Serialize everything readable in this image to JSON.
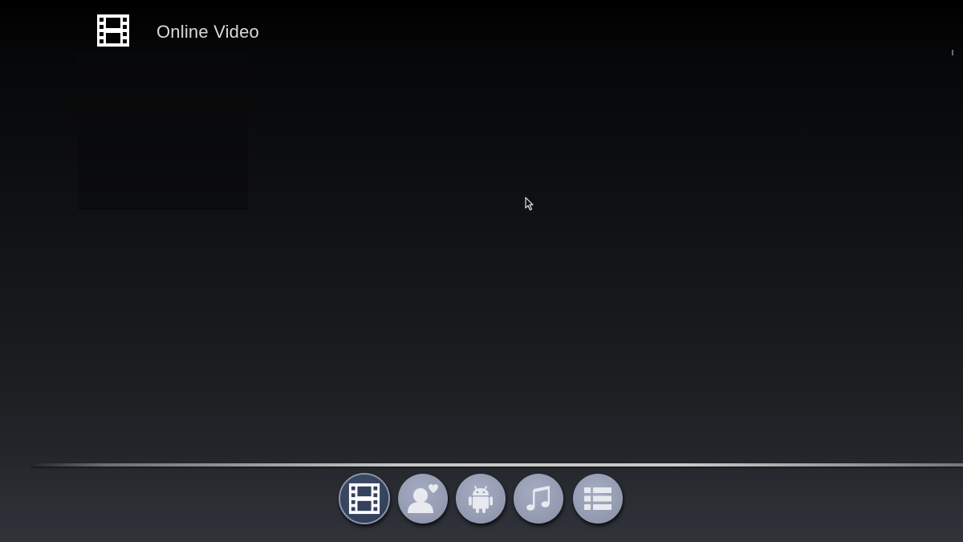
{
  "header": {
    "title": "Online Video",
    "icon": "film-icon"
  },
  "dock": {
    "items": [
      {
        "id": "videos",
        "icon": "film-icon",
        "active": true
      },
      {
        "id": "favorites",
        "icon": "user-heart-icon",
        "active": false
      },
      {
        "id": "programs",
        "icon": "android-icon",
        "active": false
      },
      {
        "id": "music",
        "icon": "music-note-icon",
        "active": false
      },
      {
        "id": "menu",
        "icon": "list-icon",
        "active": false
      }
    ]
  },
  "colors": {
    "dock_active_bg": "#33415c",
    "dock_inactive_bg": "#959cb2",
    "header_text": "#d9d9d9",
    "icon_white": "#ffffff"
  }
}
